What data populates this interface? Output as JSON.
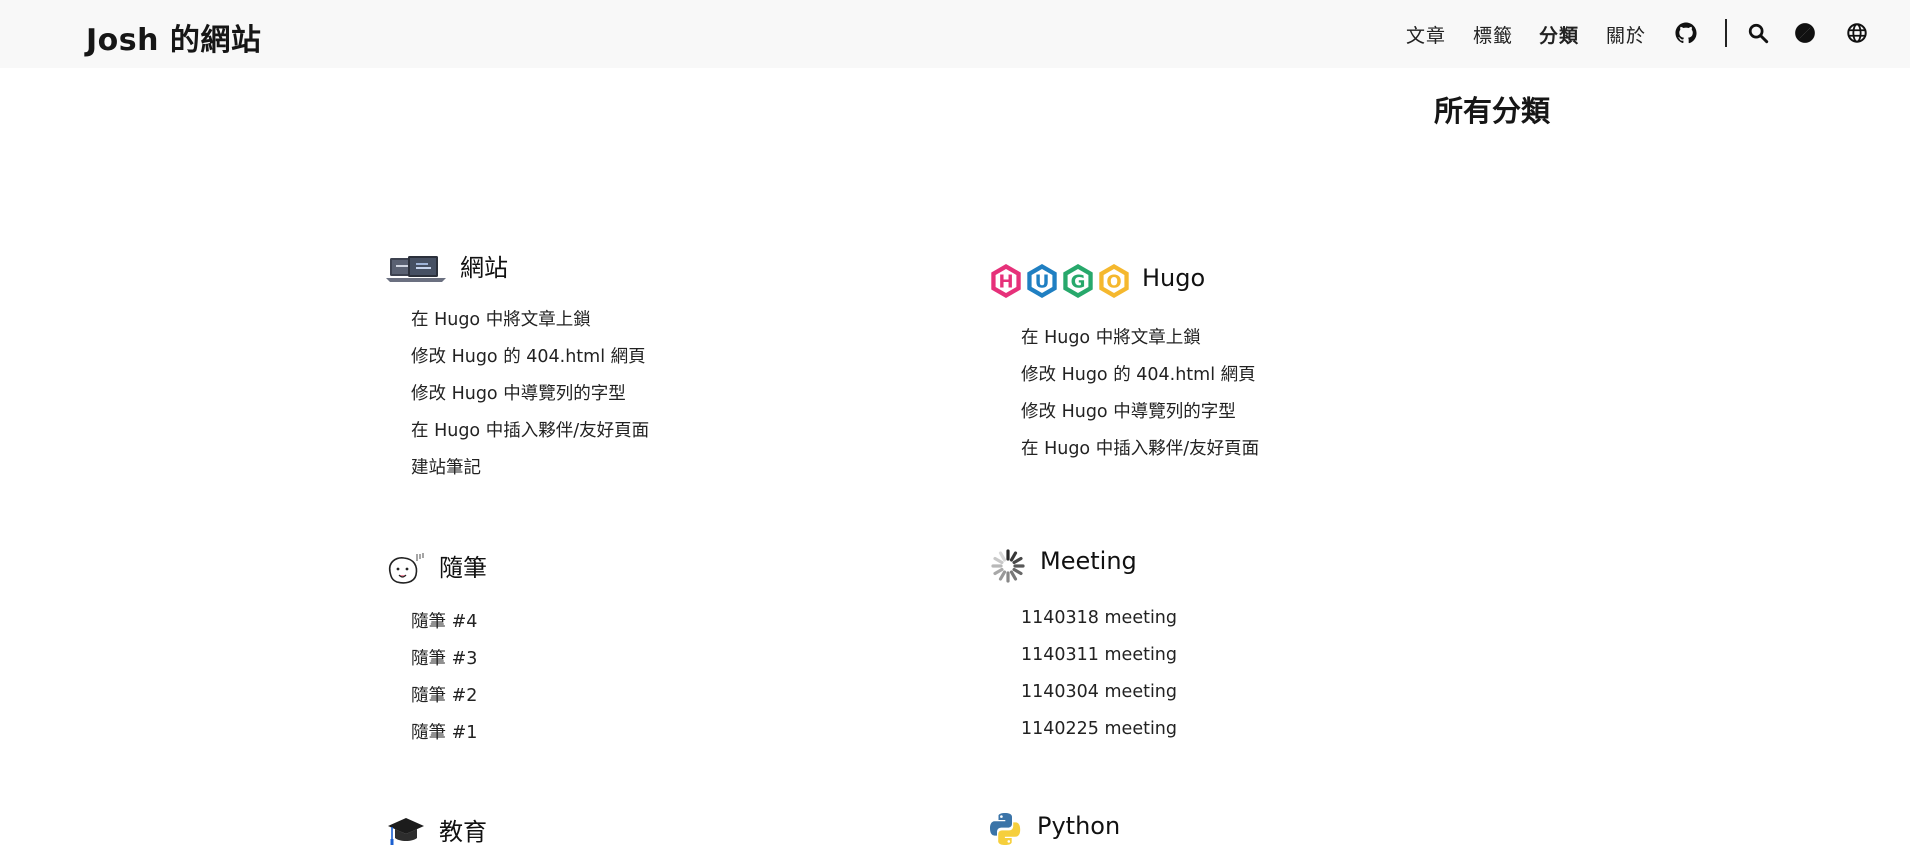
{
  "site": {
    "title": "Josh 的網站"
  },
  "nav": {
    "items": [
      {
        "label": "文章"
      },
      {
        "label": "標籤"
      },
      {
        "label": "分類"
      },
      {
        "label": "關於"
      }
    ]
  },
  "icons": {
    "github": "github-icon",
    "search": "search-icon",
    "theme": "theme-toggle-icon",
    "language": "globe-icon"
  },
  "page": {
    "title": "所有分類"
  },
  "categories": [
    {
      "name": "網站",
      "icon": "laptop-icon",
      "posts": [
        "在 Hugo 中將文章上鎖",
        "修改 Hugo 的 404.html 網頁",
        "修改 Hugo 中導覽列的字型",
        "在 Hugo 中插入夥伴/友好頁面",
        "建站筆記"
      ]
    },
    {
      "name": "Hugo",
      "icon": "hugo-logo-icon",
      "logo_letters": [
        "H",
        "U",
        "G",
        "O"
      ],
      "logo_colors": [
        "#e6317a",
        "#1f7fc2",
        "#27a86b",
        "#f5b82e"
      ],
      "posts": [
        "在 Hugo 中將文章上鎖",
        "修改 Hugo 的 404.html 網頁",
        "修改 Hugo 中導覽列的字型",
        "在 Hugo 中插入夥伴/友好頁面"
      ]
    },
    {
      "name": "隨筆",
      "icon": "doodle-face-icon",
      "posts": [
        "隨筆 #4",
        "隨筆 #3",
        "隨筆 #2",
        "隨筆 #1"
      ]
    },
    {
      "name": "Meeting",
      "icon": "spinner-icon",
      "posts": [
        "1140318 meeting",
        "1140311 meeting",
        "1140304 meeting",
        "1140225 meeting"
      ]
    },
    {
      "name": "教育",
      "icon": "graduation-cap-icon",
      "posts": []
    },
    {
      "name": "Python",
      "icon": "python-logo-icon",
      "posts": []
    }
  ]
}
